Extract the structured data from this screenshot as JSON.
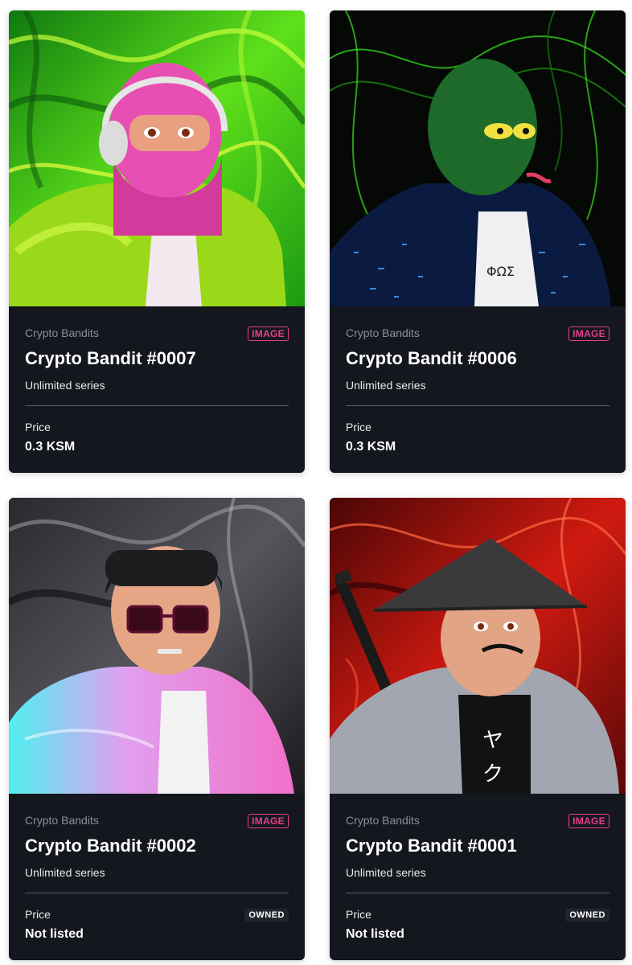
{
  "cards": [
    {
      "collection": "Crypto Bandits",
      "badge": "IMAGE",
      "title": "Crypto Bandit #0007",
      "series": "Unlimited series",
      "price_label": "Price",
      "price": "0.3 KSM",
      "owned": "",
      "image": "pink-balaclava-bandit"
    },
    {
      "collection": "Crypto Bandits",
      "badge": "IMAGE",
      "title": "Crypto Bandit #0006",
      "series": "Unlimited series",
      "price_label": "Price",
      "price": "0.3 KSM",
      "owned": "",
      "image": "green-reptile-bandit"
    },
    {
      "collection": "Crypto Bandits",
      "badge": "IMAGE",
      "title": "Crypto Bandit #0002",
      "series": "Unlimited series",
      "price_label": "Price",
      "price": "Not listed",
      "owned": "OWNED",
      "image": "sunglasses-puffer-bandit"
    },
    {
      "collection": "Crypto Bandits",
      "badge": "IMAGE",
      "title": "Crypto Bandit #0001",
      "series": "Unlimited series",
      "price_label": "Price",
      "price": "Not listed",
      "owned": "OWNED",
      "image": "samurai-hat-bandit"
    }
  ],
  "colors": {
    "card_bg": "#15171e",
    "badge": "#e53e8f",
    "text": "#ffffff",
    "muted": "#8a8f9c"
  }
}
